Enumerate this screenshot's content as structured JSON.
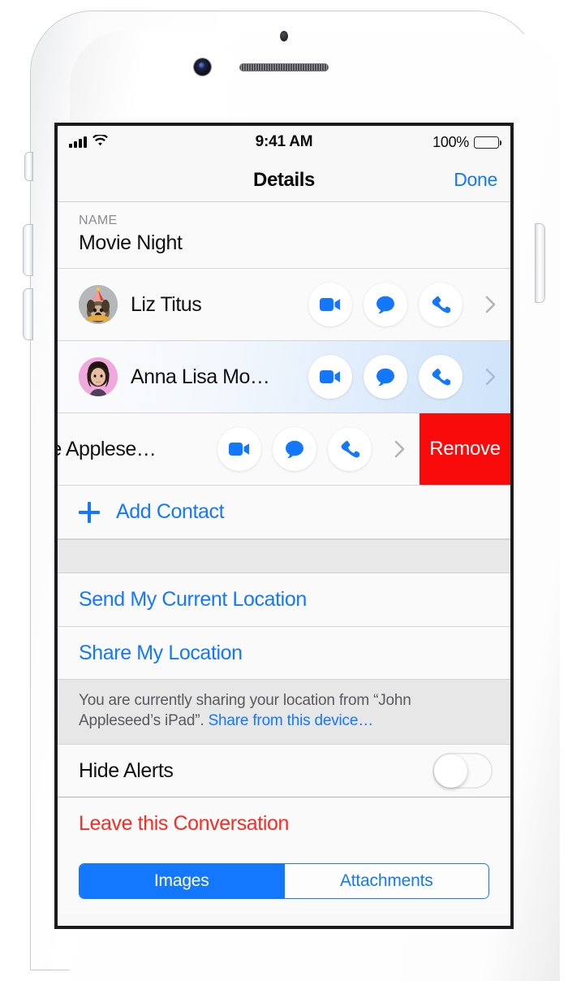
{
  "device": {
    "kind": "iphone",
    "hardware_icons": [
      "sensor-dot",
      "front-camera",
      "speaker-grille",
      "mute-switch",
      "volume-up-button",
      "volume-down-button",
      "power-button"
    ]
  },
  "status_bar": {
    "signal_bars_filled": 4,
    "wifi": "wifi-icon",
    "time": "9:41 AM",
    "battery_percent": "100%",
    "battery_level": 100
  },
  "nav_bar": {
    "title": "Details",
    "done_label": "Done"
  },
  "name_section": {
    "label": "NAME",
    "value": "Movie Night"
  },
  "contacts": [
    {
      "name": "Liz Titus",
      "avatar": "pug-dog-party-hat-avatar",
      "highlighted": false,
      "swiped": false,
      "actions": [
        "facetime-video-icon",
        "message-bubble-icon",
        "phone-call-icon"
      ],
      "disclosure": "chevron-right-icon"
    },
    {
      "name": "Anna Lisa Mo…",
      "avatar": "woman-dark-hair-avatar",
      "highlighted": true,
      "swiped": false,
      "actions": [
        "facetime-video-icon",
        "message-bubble-icon",
        "phone-call-icon"
      ],
      "disclosure": "chevron-right-icon"
    },
    {
      "name": "ne Applese…",
      "avatar": "man-avatar",
      "highlighted": false,
      "swiped": true,
      "actions": [
        "facetime-video-icon",
        "message-bubble-icon",
        "phone-call-icon"
      ],
      "disclosure": "chevron-right-icon",
      "remove_label": "Remove"
    }
  ],
  "add_contact": {
    "icon": "plus-icon",
    "label": "Add Contact"
  },
  "location": {
    "send_current": "Send My Current Location",
    "share": "Share My Location",
    "note_prefix": "You are currently sharing your location from “John Appleseed’s iPad”. ",
    "note_link": "Share from this device…"
  },
  "hide_alerts": {
    "label": "Hide Alerts",
    "enabled": false
  },
  "leave": {
    "label": "Leave this Conversation"
  },
  "segmented": {
    "options": [
      "Images",
      "Attachments"
    ],
    "selected_index": 0
  },
  "colors": {
    "tint_blue": "#1478ff",
    "destructive_red": "#fb2b23",
    "remove_red": "#fa0b0b",
    "screen_bg": "#f8f8f8",
    "group_bg": "#e9e9e9"
  }
}
